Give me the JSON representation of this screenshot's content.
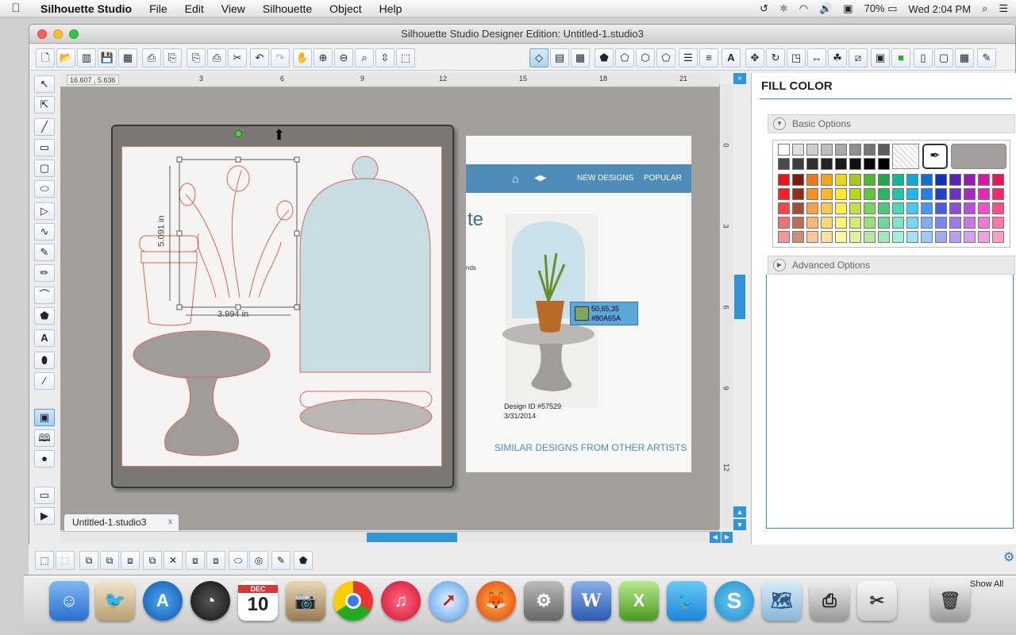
{
  "menubar": {
    "app_name": "Silhouette Studio",
    "items": [
      "File",
      "Edit",
      "View",
      "Silhouette",
      "Object",
      "Help"
    ],
    "battery": "70%",
    "clock": "Wed 2:04 PM"
  },
  "window": {
    "title": "Silhouette Studio Designer Edition: Untitled-1.studio3"
  },
  "canvas": {
    "coord_readout": "16.607 , 5.636",
    "ruler_h_labels": [
      "3",
      "6",
      "9",
      "12",
      "15",
      "18",
      "21"
    ],
    "ruler_v_labels": [
      "0",
      "3",
      "6",
      "9",
      "12"
    ],
    "dimension_height": "5.091 in",
    "dimension_width": "3.994 in",
    "document_tab": "Untitled-1.studio3",
    "tab_close": "x"
  },
  "web_panel": {
    "nav_new": "NEW DESIGNS",
    "nav_popular": "POPULAR DE",
    "logo_fragment": "te",
    "side_fragment": "nds",
    "design_id": "Design ID #57529",
    "design_date": "3/31/2014",
    "similar": "SIMILAR DESIGNS FROM OTHER ARTISTS"
  },
  "tooltip": {
    "rgb": "50,65,35",
    "hex": "#80A65A",
    "swatch_color": "#80A65A"
  },
  "right_panel": {
    "title": "FILL COLOR",
    "basic_options": "Basic Options",
    "advanced_options": "Advanced Options"
  },
  "palette": {
    "grays": [
      "#ffffff",
      "#e0e0e0",
      "#cfcfcf",
      "#bdbdbd",
      "#a9a9a9",
      "#8f8f8f",
      "#757575",
      "#5c5c5c"
    ],
    "grays2": [
      "#4a4a4a",
      "#3d3d3d",
      "#2f2f2f",
      "#232323",
      "#1a1a1a",
      "#101010",
      "#080808",
      "#000000"
    ],
    "rows": [
      [
        "#e8141c",
        "#7a1d0e",
        "#f07818",
        "#f0a818",
        "#e8d818",
        "#a8c818",
        "#50b830",
        "#20a848",
        "#10b898",
        "#10a8d8",
        "#1070d8",
        "#1030c0",
        "#6020b8",
        "#9818b8",
        "#d818a8",
        "#e81858"
      ],
      [
        "#f82020",
        "#903018",
        "#f89020",
        "#f8b828",
        "#f8e828",
        "#b8d820",
        "#60c838",
        "#28b858",
        "#20c8a8",
        "#20b8e8",
        "#2080e8",
        "#2040d0",
        "#7030c8",
        "#a828c8",
        "#e828b8",
        "#f82868"
      ],
      [
        "#f04848",
        "#a05038",
        "#f8a048",
        "#f8c850",
        "#f8f048",
        "#c8e048",
        "#78d858",
        "#48c878",
        "#48d8b8",
        "#48c8f0",
        "#4898f0",
        "#4860e0",
        "#8850d8",
        "#b850d8",
        "#f050c8",
        "#f85088"
      ],
      [
        "#f07070",
        "#b87050",
        "#f8b870",
        "#f8d878",
        "#f8f870",
        "#d8e870",
        "#98e078",
        "#70d898",
        "#78e8c8",
        "#78d8f8",
        "#78b0f8",
        "#7888f0",
        "#a078e8",
        "#c878e8",
        "#f078d8",
        "#f878a8"
      ],
      [
        "#f09898",
        "#c89070",
        "#f8c898",
        "#f8e0a0",
        "#f8f8a0",
        "#e0f0a0",
        "#b8e8a0",
        "#a0e8b8",
        "#a0f0d8",
        "#a0e0f8",
        "#a0c8f8",
        "#a0a8f0",
        "#b8a0f0",
        "#d8a0f0",
        "#f0a0e8",
        "#f8a0c0"
      ]
    ],
    "selected_color": "#a39f9d"
  },
  "dock": {
    "calendar_month": "DEC",
    "calendar_day": "10",
    "show_all": "Show All"
  }
}
